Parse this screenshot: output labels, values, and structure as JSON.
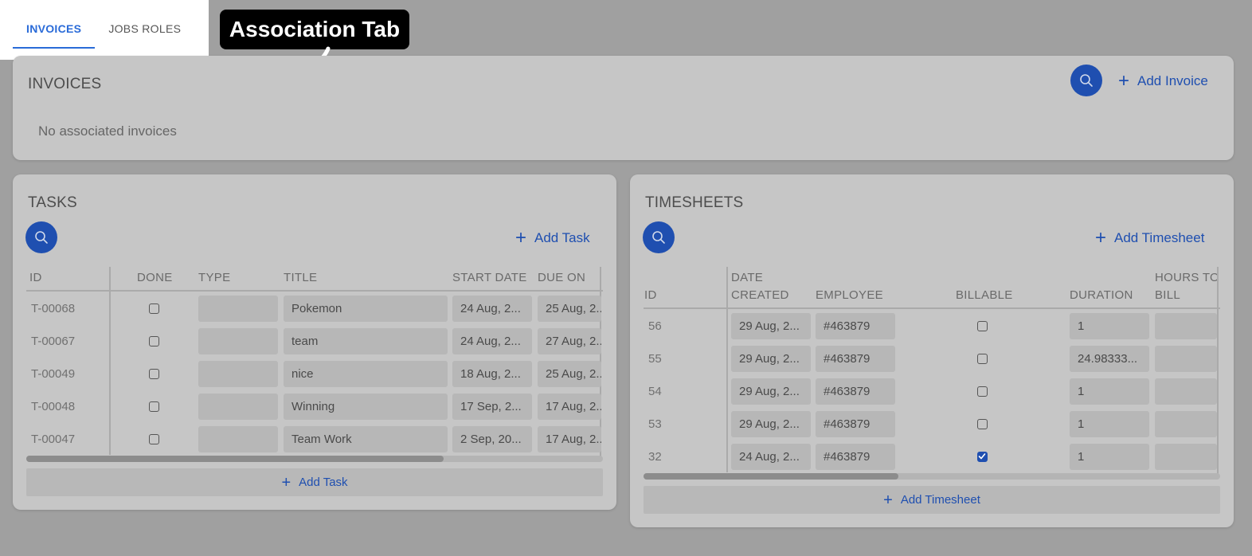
{
  "tabs": [
    {
      "label": "INVOICES",
      "active": true
    },
    {
      "label": "JOBS ROLES",
      "active": false
    }
  ],
  "callout": "Association Tab",
  "invoices": {
    "title": "INVOICES",
    "add_label": "Add Invoice",
    "empty_text": "No associated invoices"
  },
  "tasks": {
    "title": "TASKS",
    "add_label": "Add Task",
    "footer_add_label": "Add Task",
    "columns": [
      "ID",
      "DONE",
      "TYPE",
      "TITLE",
      "START DATE",
      "DUE ON"
    ],
    "rows": [
      {
        "id": "T-00068",
        "done": false,
        "type": "",
        "title": "Pokemon",
        "start": "24 Aug, 2...",
        "due": "25 Aug, 2..."
      },
      {
        "id": "T-00067",
        "done": false,
        "type": "",
        "title": "team",
        "start": "24 Aug, 2...",
        "due": "27 Aug, 2..."
      },
      {
        "id": "T-00049",
        "done": false,
        "type": "",
        "title": "nice",
        "start": "18 Aug, 2...",
        "due": "25 Aug, 2..."
      },
      {
        "id": "T-00048",
        "done": false,
        "type": "",
        "title": "Winning",
        "start": "17 Sep, 2...",
        "due": "17 Aug, 2..."
      },
      {
        "id": "T-00047",
        "done": false,
        "type": "",
        "title": "Team Work",
        "start": "2 Sep, 20...",
        "due": "17 Aug, 2..."
      }
    ]
  },
  "timesheets": {
    "title": "TIMESHEETS",
    "add_label": "Add Timesheet",
    "footer_add_label": "Add Timesheet",
    "columns": [
      "ID",
      "DATE CREATED",
      "EMPLOYEE",
      "BILLABLE",
      "DURATION",
      "HOURS TO BILL"
    ],
    "column_lines": [
      [
        "",
        "ID"
      ],
      [
        "DATE",
        "CREATED"
      ],
      [
        "",
        "EMPLOYEE"
      ],
      [
        "",
        "BILLABLE"
      ],
      [
        "",
        "DURATION"
      ],
      [
        "HOURS TO",
        "BILL"
      ]
    ],
    "rows": [
      {
        "id": "56",
        "date": "29 Aug, 2...",
        "employee": "#463879",
        "billable": false,
        "duration": "1",
        "hours": ""
      },
      {
        "id": "55",
        "date": "29 Aug, 2...",
        "employee": "#463879",
        "billable": false,
        "duration": "24.98333...",
        "hours": ""
      },
      {
        "id": "54",
        "date": "29 Aug, 2...",
        "employee": "#463879",
        "billable": false,
        "duration": "1",
        "hours": ""
      },
      {
        "id": "53",
        "date": "29 Aug, 2...",
        "employee": "#463879",
        "billable": false,
        "duration": "1",
        "hours": ""
      },
      {
        "id": "32",
        "date": "24 Aug, 2...",
        "employee": "#463879",
        "billable": true,
        "duration": "1",
        "hours": ""
      }
    ]
  },
  "colors": {
    "accent": "#1f4fb0",
    "tab_active": "#2a6bd8",
    "overlay": "#a0a0a0"
  }
}
